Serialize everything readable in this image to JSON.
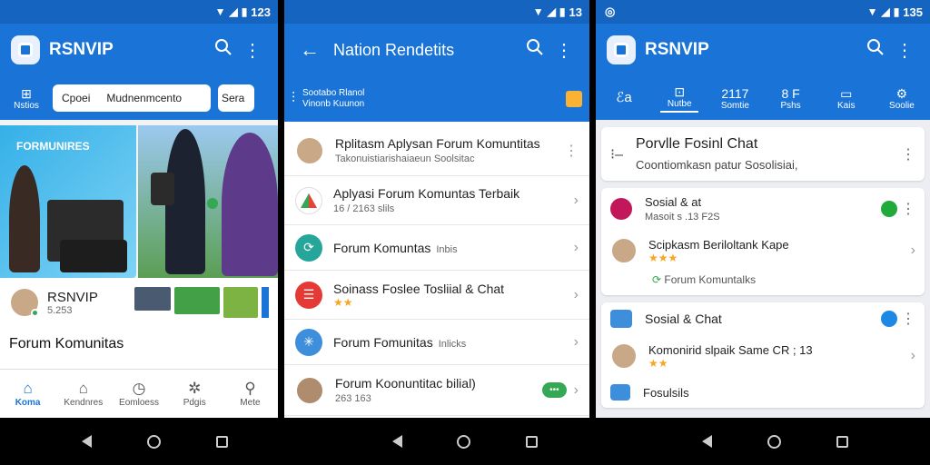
{
  "statusbar": {
    "time_1": "123",
    "time_2": "13",
    "time_3": "135"
  },
  "screen1": {
    "app_title": "RSNVIP",
    "subbar": {
      "tab_label": "Nstios",
      "chip_1": "Cpoei",
      "chip_2": "Mudnenmcento",
      "chip_3": "Sera"
    },
    "hero_badge": "FORMUNIRES",
    "app_name": "RSNVIP",
    "app_count": "5.253",
    "section_title": "Forum Komunitas",
    "bottom_nav": [
      {
        "icon": "home-icon",
        "label": "Koma"
      },
      {
        "icon": "home-outline-icon",
        "label": "Kendnres"
      },
      {
        "icon": "clock-icon",
        "label": "Eomloess"
      },
      {
        "icon": "puzzle-icon",
        "label": "Pdgis"
      },
      {
        "icon": "search-icon",
        "label": "Mete"
      }
    ]
  },
  "screen2": {
    "app_title": "Nation Rendetits",
    "subbar_line1": "Sootabo Rlanol",
    "subbar_line2": "Vinonb Kuunon",
    "list": [
      {
        "title": "Rplitasm Aplysan Forum Komuntitas",
        "sub": "Takonuistiarishaiaeun Soolsitac"
      },
      {
        "title": "Aplyasi Forum Komuntas Terbaik",
        "sub": "16 / 2163 slils"
      },
      {
        "title": "Forum Komuntas",
        "sub_inline": "Inbis"
      },
      {
        "title": "Soinass Foslee Tosliial & Chat",
        "stars": "★★"
      },
      {
        "title": "Forum Fomunitas",
        "sub_inline": "Inlicks"
      },
      {
        "title": "Forum Koonuntitac bilial)",
        "sub": "263 163",
        "pill": "•••"
      }
    ]
  },
  "screen3": {
    "app_title": "RSNVIP",
    "tabs": [
      {
        "icon": "fa-icon",
        "label": ""
      },
      {
        "icon": "tag-icon",
        "label": "Nutbe"
      },
      {
        "icon": "",
        "top": "2117",
        "label": "Somtie"
      },
      {
        "icon": "",
        "top": "8 F",
        "label": "Pshs"
      },
      {
        "icon": "list-icon",
        "label": "Kais"
      },
      {
        "icon": "gear-icon",
        "label": "Soolie"
      }
    ],
    "card1": {
      "title": "Porvlle Fosinl Chat",
      "sub": "Coontiomkasn patur Sosolisiai,"
    },
    "card2": {
      "row1_title": "Sosial & at",
      "row1_sub": "Masoit s .13 F2S",
      "row2_title": "Scipkasm Beriloltank Kape",
      "row2_stars": "★★★",
      "footer": "Forum Komuntalks"
    },
    "card3": {
      "row1_title": "Sosial & Chat",
      "row2_title": "Komonirid slpaik Same CR ; 13",
      "row2_stars": "★★",
      "row3_title": "Fosulsils"
    }
  }
}
